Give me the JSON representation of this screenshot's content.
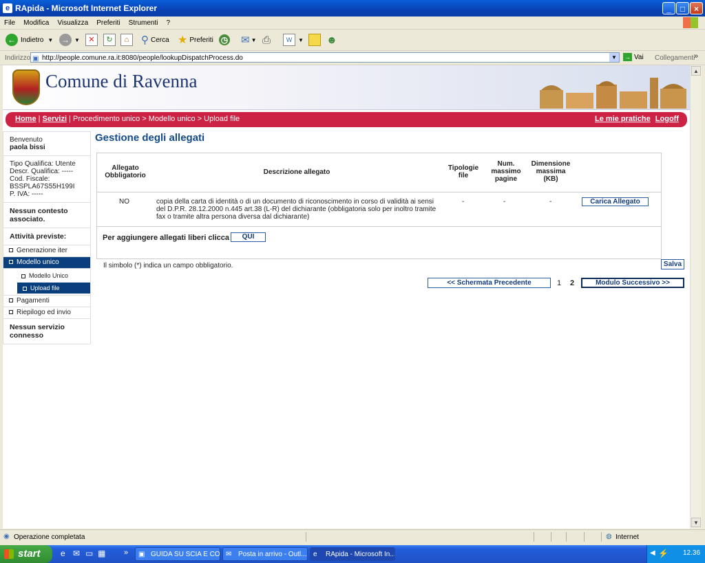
{
  "window": {
    "title": "RApida - Microsoft Internet Explorer"
  },
  "menu": [
    "File",
    "Modifica",
    "Visualizza",
    "Preferiti",
    "Strumenti",
    "?"
  ],
  "toolbar": {
    "back": "Indietro",
    "search": "Cerca",
    "favorites": "Preferiti"
  },
  "address": {
    "label": "Indirizzo",
    "url": "http://people.comune.ra.it:8080/people/lookupDispatchProcess.do",
    "go": "Vai",
    "links": "Collegamenti"
  },
  "banner": {
    "title": "Comune di Ravenna"
  },
  "nav": {
    "home": "Home",
    "sep1": "|",
    "servizi": "Servizi",
    "path": "| Procedimento unico > Modello unico > Upload file",
    "mie_pratiche": "Le mie pratiche",
    "logoff": "Logoff"
  },
  "sidebar": {
    "welcome": "Benvenuto",
    "user": "paola bissi",
    "info": [
      "Tipo Qualifica: Utente",
      "Descr. Qualifica: -----",
      "Cod. Fiscale:",
      "BSSPLA67S55H199I",
      "P. IVA: -----"
    ],
    "context": "Nessun contesto associato.",
    "activities": "Attività previste:",
    "items": [
      {
        "label": "Generazione iter"
      },
      {
        "label": "Modello unico"
      },
      {
        "label": "Modello Unico"
      },
      {
        "label": "Upload file"
      },
      {
        "label": "Pagamenti"
      },
      {
        "label": "Riepilogo ed invio"
      }
    ],
    "no_service": "Nessun servizio connesso"
  },
  "main": {
    "title": "Gestione degli allegati",
    "headers": {
      "obbl": "Allegato Obbligatorio",
      "desc": "Descrizione allegato",
      "tipologie": "Tipologie file",
      "pagine": "Num. massimo pagine",
      "dimensione": "Dimensione massima (KB)"
    },
    "row": {
      "obbl": "NO",
      "desc": "copia della carta di identità o di un documento di riconoscimento in corso di validità ai sensi del D.P.R. 28.12.2000 n.445 art.38 (L-R) del dichiarante (obbligatoria solo per inoltro tramite fax o tramite altra persona diversa dal dichiarante)",
      "tipologie": "-",
      "pagine": "-",
      "dimensione": "-",
      "button": "Carica Allegato"
    },
    "free_text": "Per aggiungere allegati liberi clicca",
    "free_button": "QUI",
    "note": "Il simbolo (*) indica un campo obbligatorio.",
    "save": "Salva",
    "prev": "<< Schermata Precedente",
    "page1": "1",
    "page2": "2",
    "next": "Modulo Successivo >>"
  },
  "status": {
    "text": "Operazione completata",
    "zone": "Internet"
  },
  "taskbar": {
    "start": "start",
    "tasks": [
      "GUIDA SU SCIA E CO...",
      "Posta in arrivo - Outl...",
      "RApida - Microsoft In..."
    ],
    "clock": "12.36"
  },
  "colors": {
    "accent": "#cc2244",
    "nav_active": "#0a3f7d",
    "title_blue": "#124a87"
  }
}
